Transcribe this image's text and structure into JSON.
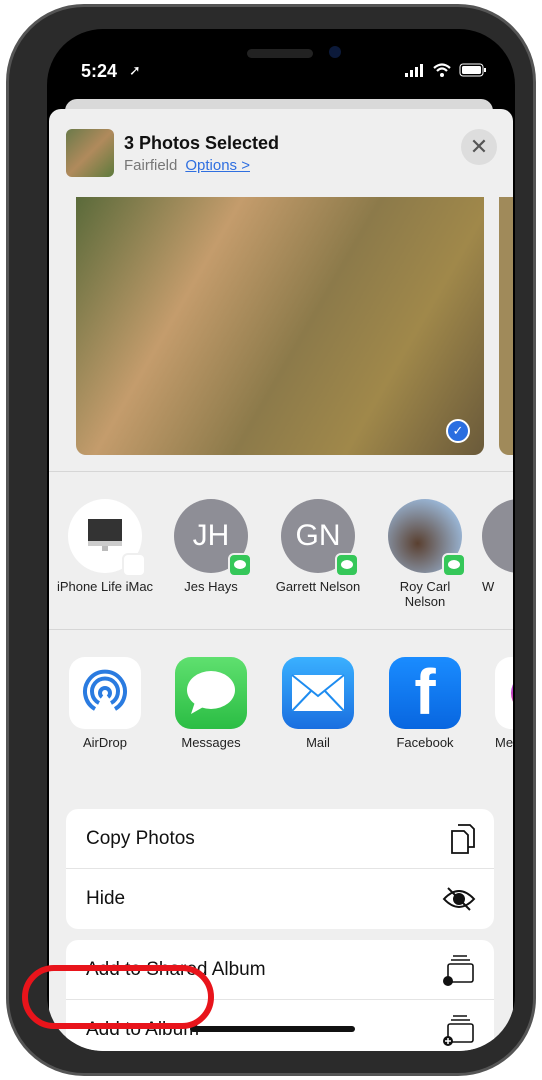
{
  "status_bar": {
    "time": "5:24"
  },
  "header": {
    "title": "3 Photos Selected",
    "location": "Fairfield",
    "options_label": "Options >"
  },
  "people": [
    {
      "name": "iPhone Life iMac",
      "badge": "airdrop"
    },
    {
      "initials": "JH",
      "name": "Jes Hays",
      "badge": "messages"
    },
    {
      "initials": "GN",
      "name": "Garrett Nelson",
      "badge": "messages"
    },
    {
      "name": "Roy Carl Nelson",
      "badge": "messages"
    },
    {
      "name": "W"
    }
  ],
  "apps": [
    {
      "label": "AirDrop",
      "color": "#2a7be0"
    },
    {
      "label": "Messages",
      "color": "#35c759"
    },
    {
      "label": "Mail",
      "color": "#1e8cf0"
    },
    {
      "label": "Facebook",
      "color": "#1877f2"
    },
    {
      "label": "Me",
      "color": "#a040f0"
    }
  ],
  "actions_group1": [
    {
      "label": "Copy Photos",
      "icon": "copy-icon"
    },
    {
      "label": "Hide",
      "icon": "eye-slash-icon"
    }
  ],
  "actions_group2": [
    {
      "label": "Add to Shared Album",
      "icon": "shared-album-icon"
    },
    {
      "label": "Add to Album",
      "icon": "add-album-icon"
    }
  ],
  "annotation_color": "#e8141b"
}
